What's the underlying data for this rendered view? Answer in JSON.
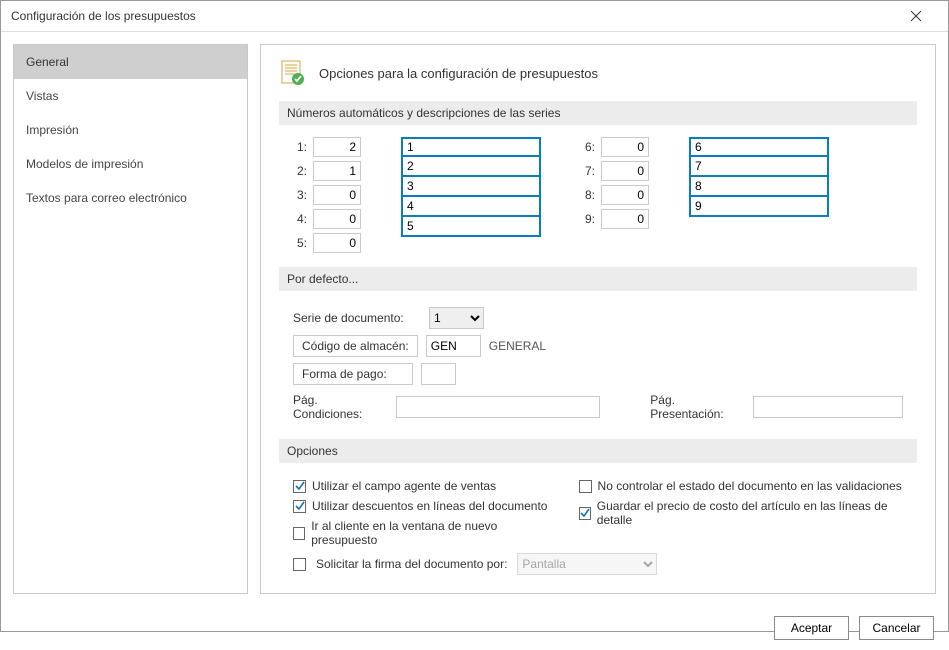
{
  "window": {
    "title": "Configuración de los presupuestos"
  },
  "sidebar": {
    "items": [
      {
        "label": "General"
      },
      {
        "label": "Vistas"
      },
      {
        "label": "Impresión"
      },
      {
        "label": "Modelos de impresión"
      },
      {
        "label": "Textos para correo electrónico"
      }
    ],
    "selected_index": 0
  },
  "header": {
    "title": "Opciones para la configuración de presupuestos"
  },
  "sections": {
    "series": "Números automáticos y descripciones de las series",
    "defaults": "Por defecto...",
    "options": "Opciones"
  },
  "series": {
    "rows": [
      {
        "idx": "1:",
        "num": "2",
        "desc": "1"
      },
      {
        "idx": "2:",
        "num": "1",
        "desc": "2"
      },
      {
        "idx": "3:",
        "num": "0",
        "desc": "3"
      },
      {
        "idx": "4:",
        "num": "0",
        "desc": "4"
      },
      {
        "idx": "5:",
        "num": "0",
        "desc": "5"
      },
      {
        "idx": "6:",
        "num": "0",
        "desc": "6"
      },
      {
        "idx": "7:",
        "num": "0",
        "desc": "7"
      },
      {
        "idx": "8:",
        "num": "0",
        "desc": "8"
      },
      {
        "idx": "9:",
        "num": "0",
        "desc": "9"
      }
    ]
  },
  "defaults": {
    "serie_doc_label": "Serie de documento:",
    "serie_doc_value": "1",
    "codigo_almacen_label": "Código de almacén:",
    "codigo_almacen_value": "GEN",
    "codigo_almacen_desc": "GENERAL",
    "forma_pago_label": "Forma de pago:",
    "forma_pago_value": "",
    "pag_condiciones_label": "Pág. Condiciones:",
    "pag_condiciones_value": "",
    "pag_presentacion_label": "Pág. Presentación:",
    "pag_presentacion_value": ""
  },
  "options": {
    "left": [
      {
        "label": "Utilizar el campo agente de ventas",
        "checked": true
      },
      {
        "label": "Utilizar descuentos en líneas del documento",
        "checked": true
      },
      {
        "label": "Ir al cliente en la ventana de nuevo presupuesto",
        "checked": false
      }
    ],
    "right": [
      {
        "label": "No controlar el estado del documento en las validaciones",
        "checked": false
      },
      {
        "label": "Guardar el precio de costo del artículo en las líneas de detalle",
        "checked": true
      }
    ],
    "signature": {
      "label": "Solicitar la firma del documento por:",
      "checked": false,
      "value": "Pantalla"
    }
  },
  "footer": {
    "accept": "Aceptar",
    "cancel": "Cancelar"
  }
}
